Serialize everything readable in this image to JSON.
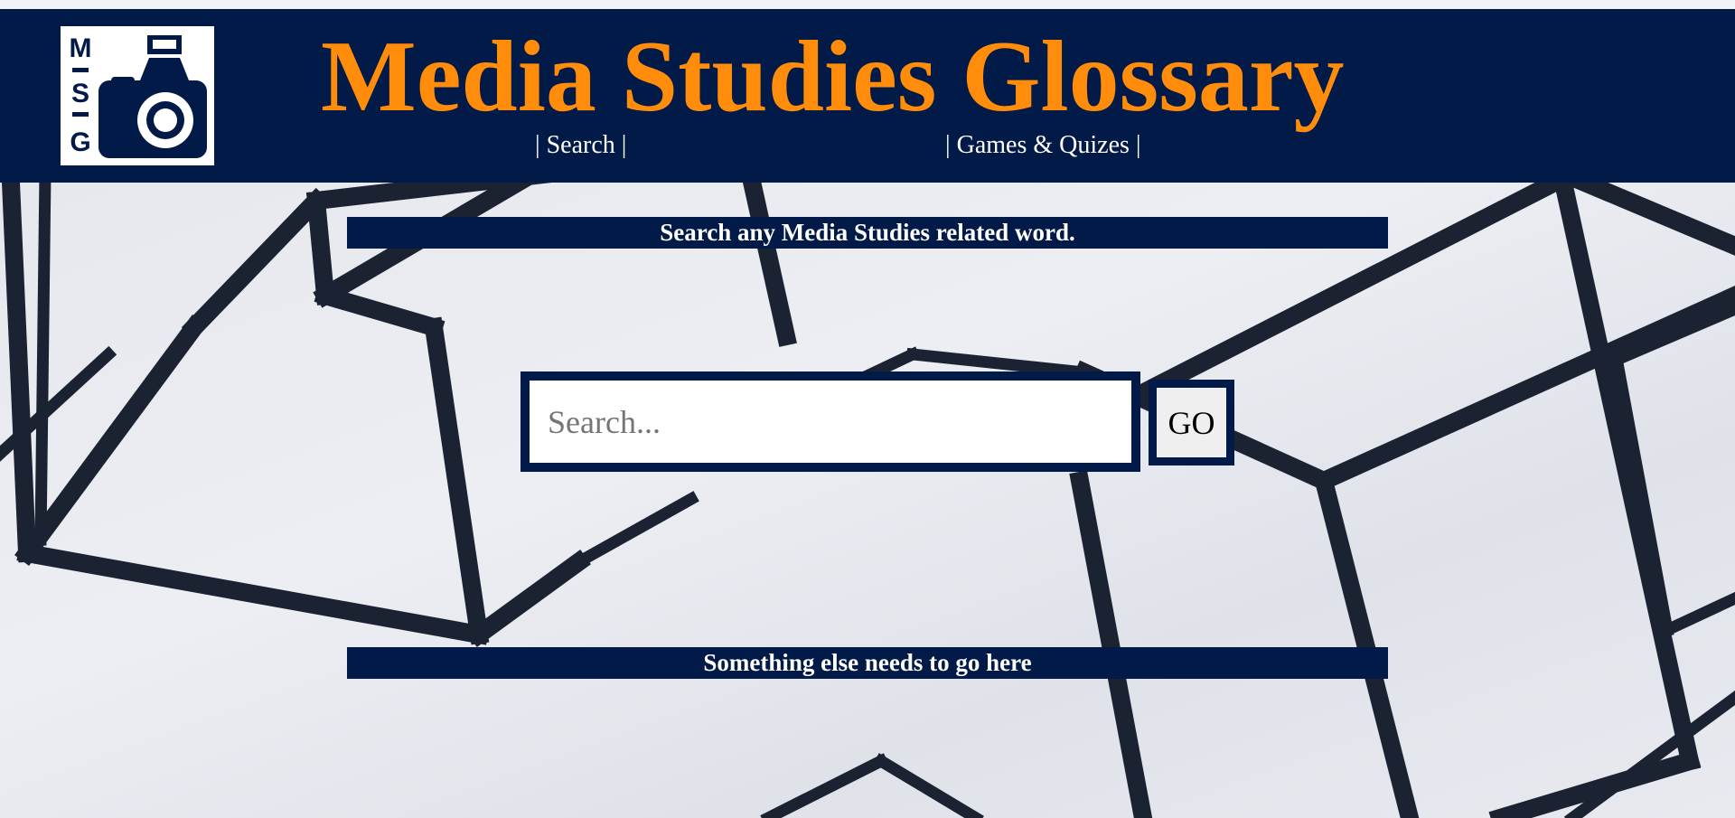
{
  "header": {
    "logo_letters": [
      "M",
      "S",
      "G"
    ],
    "title": "Media Studies Glossary",
    "nav": {
      "search": "| Search |",
      "games": "| Games & Quizes |"
    }
  },
  "main": {
    "banner_top": "Search any Media Studies related word.",
    "search": {
      "placeholder": "Search...",
      "value": ""
    },
    "go_label": "GO",
    "banner_bottom": "Something else needs to go here"
  },
  "colors": {
    "navy": "#011a47",
    "title_orange": "#ff8c0a",
    "white": "#ffffff"
  }
}
